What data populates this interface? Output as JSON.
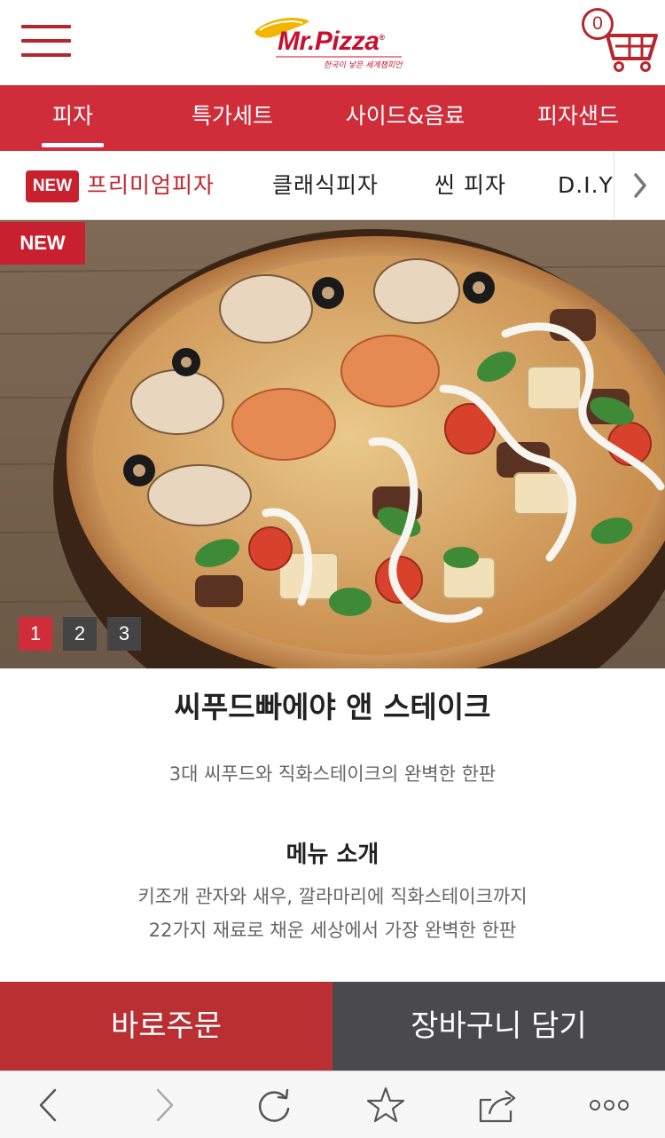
{
  "header": {
    "menu_icon": "hamburger-menu-icon",
    "logo": {
      "brand": "Mr.Pizza",
      "registered": "®",
      "tagline": "한국이 낳은 세계챔피언"
    },
    "cart": {
      "icon": "shopping-cart-icon",
      "count": "0"
    }
  },
  "main_nav": {
    "tabs": [
      {
        "label": "피자",
        "active": true
      },
      {
        "label": "특가세트",
        "active": false
      },
      {
        "label": "사이드&음료",
        "active": false
      },
      {
        "label": "피자샌드",
        "active": false
      }
    ]
  },
  "sub_nav": {
    "badge": "NEW",
    "items": [
      {
        "label": "프리미엄피자",
        "active": true
      },
      {
        "label": "클래식피자",
        "active": false
      },
      {
        "label": "씬 피자",
        "active": false
      },
      {
        "label": "D.I.Y",
        "active": false
      }
    ],
    "arrow_icon": "chevron-right-icon"
  },
  "hero": {
    "badge": "NEW",
    "image": "seafood-paella-steak-pizza-photo",
    "pagination": [
      "1",
      "2",
      "3"
    ],
    "active_page": 1
  },
  "product": {
    "name": "씨푸드빠에야 앤 스테이크",
    "subtitle": "3대 씨푸드와 직화스테이크의 완벽한 한판",
    "intro_title": "메뉴 소개",
    "intro_lines": [
      "키조개 관자와 새우, 깔라마리에 직화스테이크까지",
      "22가지 재료로 채운 세상에서 가장 완벽한 한판"
    ]
  },
  "actions": {
    "order_now": "바로주문",
    "add_to_cart": "장바구니 담기"
  },
  "browser_toolbar": {
    "icons": [
      "back-arrow-icon",
      "forward-arrow-icon",
      "refresh-icon",
      "bookmark-star-icon",
      "share-icon",
      "more-dots-icon"
    ]
  },
  "colors": {
    "brand_red": "#d02d3b",
    "order_button": "#b92f32",
    "cart_button": "#4a4a4c",
    "pagination_active": "#d02d3b",
    "pagination_inactive": "#444444"
  }
}
